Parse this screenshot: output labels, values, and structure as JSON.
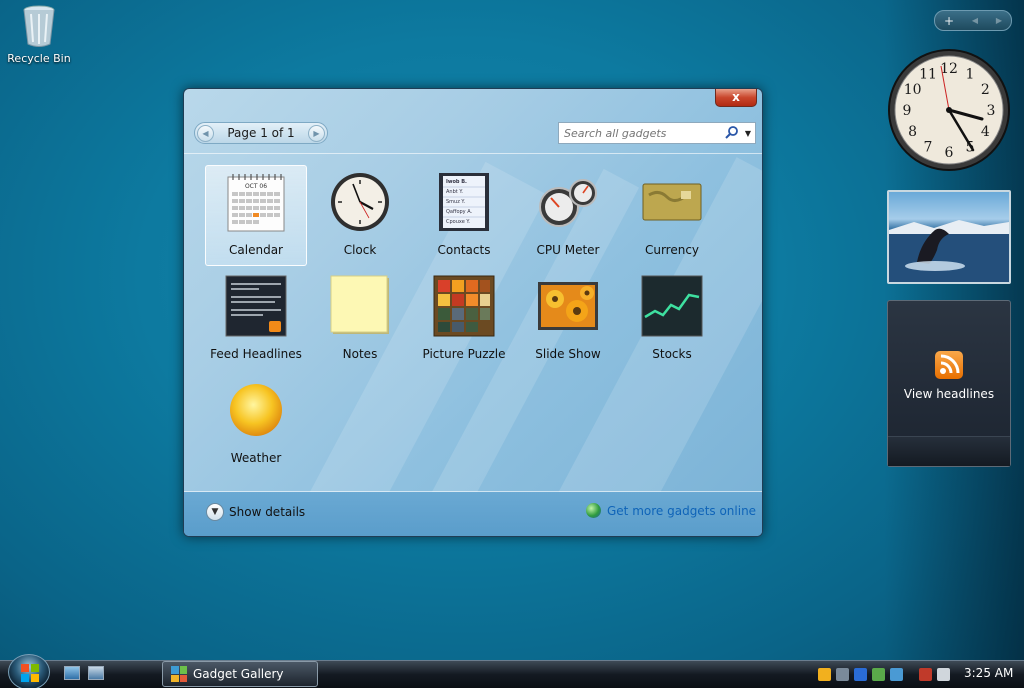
{
  "desktop": {
    "recycle_bin_label": "Recycle Bin"
  },
  "gallery": {
    "pager_text": "Page 1 of 1",
    "search_placeholder": "Search all gadgets",
    "close_label": "x",
    "gadgets": [
      {
        "name": "Calendar",
        "selected": true,
        "icon": "calendar-icon"
      },
      {
        "name": "Clock",
        "icon": "clock-icon"
      },
      {
        "name": "Contacts",
        "icon": "contacts-icon"
      },
      {
        "name": "CPU Meter",
        "icon": "cpu-meter-icon"
      },
      {
        "name": "Currency",
        "icon": "currency-icon"
      },
      {
        "name": "Feed Headlines",
        "icon": "feed-headlines-icon"
      },
      {
        "name": "Notes",
        "icon": "notes-icon"
      },
      {
        "name": "Picture Puzzle",
        "icon": "picture-puzzle-icon"
      },
      {
        "name": "Slide Show",
        "icon": "slide-show-icon"
      },
      {
        "name": "Stocks",
        "icon": "stocks-icon"
      },
      {
        "name": "Weather",
        "icon": "weather-icon"
      }
    ],
    "calendar_month": "OCT 06",
    "contacts_lines": [
      "Iwob B.",
      "Anbt Y.",
      "Smuz Y.",
      "Qaffopy A.",
      "Cpouxe Y."
    ],
    "show_details_label": "Show details",
    "get_more_label": "Get more gadgets online"
  },
  "sidebar": {
    "add_label": "+",
    "clock_numbers": [
      "12",
      "1",
      "2",
      "3",
      "4",
      "5",
      "6",
      "7",
      "8",
      "9",
      "10",
      "11"
    ],
    "feed_label": "View headlines"
  },
  "taskbar": {
    "task_label": "Gadget Gallery",
    "time": "3:25 AM"
  },
  "colors": {
    "desktop": "#0d7aa0",
    "accent_link": "#0f64b8",
    "close_red": "#c9462c"
  }
}
